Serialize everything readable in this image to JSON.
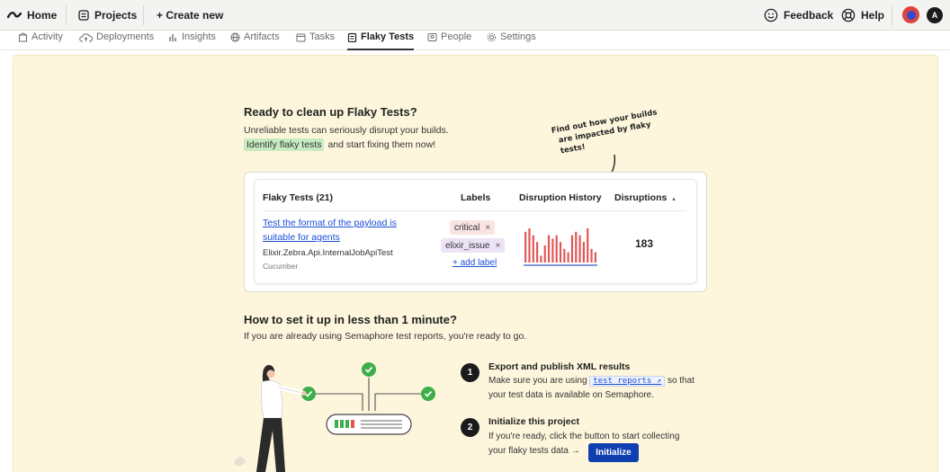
{
  "topbar": {
    "home": "Home",
    "projects": "Projects",
    "create_new": "+ Create new",
    "feedback": "Feedback",
    "help": "Help",
    "user_initial": "A"
  },
  "tabs": [
    "Activity",
    "Deployments",
    "Insights",
    "Artifacts",
    "Tasks",
    "Flaky Tests",
    "People",
    "Settings"
  ],
  "active_tab": "Flaky Tests",
  "hero": {
    "title": "Ready to clean up Flaky Tests?",
    "line1": "Unreliable tests can seriously disrupt your builds.",
    "highlight": "Identify flaky tests",
    "line2_rest": "and start fixing them now!",
    "callout_1": "Find out how your builds",
    "callout_2": "are impacted by flaky tests!"
  },
  "preview": {
    "headers": {
      "tests": "Flaky Tests (21)",
      "labels": "Labels",
      "history": "Disruption History",
      "disruptions": "Disruptions"
    },
    "sort_glyph": "▴",
    "test_name": "Test the format of the payload is suitable for agents",
    "suite": "Elixir.Zebra.Api.InternalJobApiTest",
    "runner": "Cucumber",
    "labels": [
      {
        "text": "critical",
        "bg": "#f9e3e3"
      },
      {
        "text": "elixir_issue",
        "bg": "#ece3f7"
      }
    ],
    "chip_close": "×",
    "add_label": "+ add label",
    "disruptions": "183",
    "history": [
      9,
      10,
      8,
      6,
      2,
      5,
      8,
      7,
      8,
      6,
      4,
      3,
      8,
      9,
      8,
      6,
      10,
      4,
      3
    ],
    "bar_color": "#e25555"
  },
  "setup": {
    "title": "How to set it up in less than 1 minute?",
    "subtitle": "If you are already using Semaphore test reports, you're ready to go.",
    "step1": {
      "num": "1",
      "title": "Export and publish XML results",
      "text_before": "Make sure you are using",
      "link": "test_reports ↗",
      "text_after": "so that",
      "text_line2": "your test data is available on Semaphore."
    },
    "step2": {
      "num": "2",
      "title": "Initialize this project",
      "text_line1": "If you're ready, click the button to start collecting",
      "text_line2": "your flaky tests data →",
      "button": "Initialize"
    }
  },
  "colors": {
    "panel_bg": "#fdf6dc",
    "link": "#1a4fd6",
    "primary_button": "#0f3fb0",
    "highlight": "#c7ebc0",
    "check_green": "#3cae4a"
  }
}
